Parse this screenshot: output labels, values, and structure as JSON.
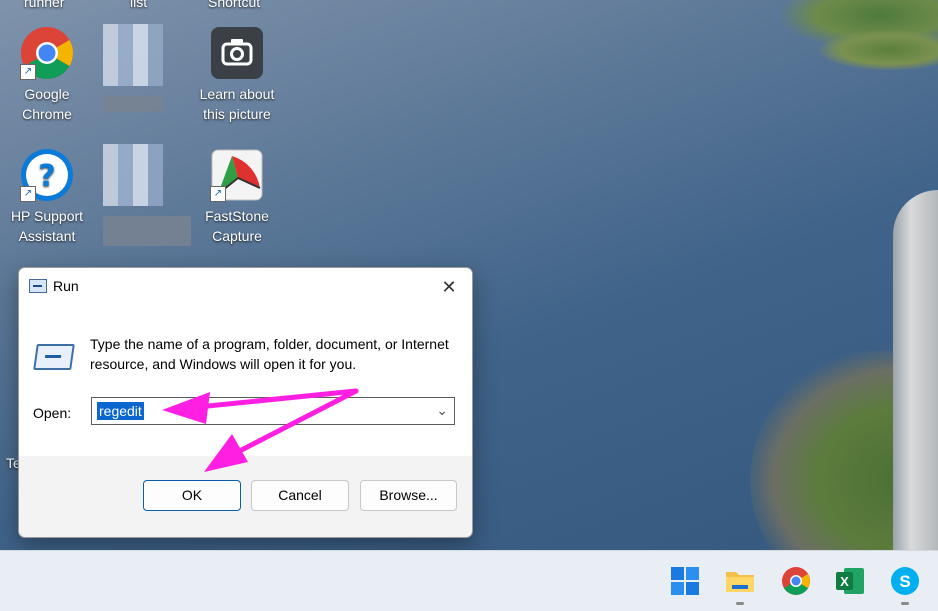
{
  "desktop": {
    "top_labels": [
      "runner",
      "list",
      "Shortcut"
    ],
    "icons": [
      {
        "label_line1": "Google",
        "label_line2": "Chrome"
      },
      {
        "label_line1": "Learn about",
        "label_line2": "this picture"
      },
      {
        "label_line1": "HP Support",
        "label_line2": "Assistant"
      },
      {
        "label_line1": "FastStone",
        "label_line2": "Capture"
      }
    ],
    "partial_label": "Te"
  },
  "run_dialog": {
    "title": "Run",
    "close_glyph": "✕",
    "description": "Type the name of a program, folder, document, or Internet resource, and Windows will open it for you.",
    "open_label": "Open:",
    "open_value": "regedit",
    "dropdown_glyph": "⌄",
    "buttons": {
      "ok": "OK",
      "cancel": "Cancel",
      "browse": "Browse..."
    }
  },
  "annotation": {
    "arrow_color": "#ff1fe3"
  },
  "colors": {
    "accent": "#0b66cf",
    "taskbar": "#e9edf4"
  },
  "taskbar": {
    "icons": [
      "windows-start-icon",
      "file-explorer-icon",
      "chrome-icon",
      "excel-icon",
      "skype-icon"
    ],
    "excel_letter": "X",
    "skype_letter": "S"
  }
}
